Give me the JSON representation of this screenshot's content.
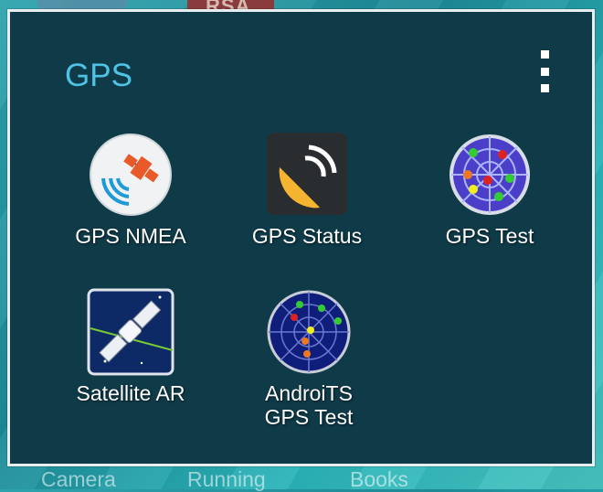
{
  "folder": {
    "title": "GPS",
    "menu_icon": "more-vert-icon"
  },
  "apps": [
    {
      "label": "GPS NMEA",
      "icon": "gps-nmea-satellite-icon"
    },
    {
      "label": "GPS Status",
      "icon": "gps-status-dish-icon"
    },
    {
      "label": "GPS Test",
      "icon": "gps-test-radar-icon"
    },
    {
      "label": "Satellite AR",
      "icon": "satellite-ar-icon"
    },
    {
      "label": "AndroiTS GPS Test",
      "label_line1": "AndroiTS",
      "label_line2": "GPS Test",
      "icon": "androits-radar-icon"
    }
  ],
  "dock": {
    "items": [
      "Camera",
      "Running",
      "Books"
    ]
  },
  "background": {
    "partial_tile_text": "RSA"
  },
  "colors": {
    "folder_bg": "#0f3a48",
    "title": "#4fc3e6",
    "border": "#e8eef0"
  }
}
